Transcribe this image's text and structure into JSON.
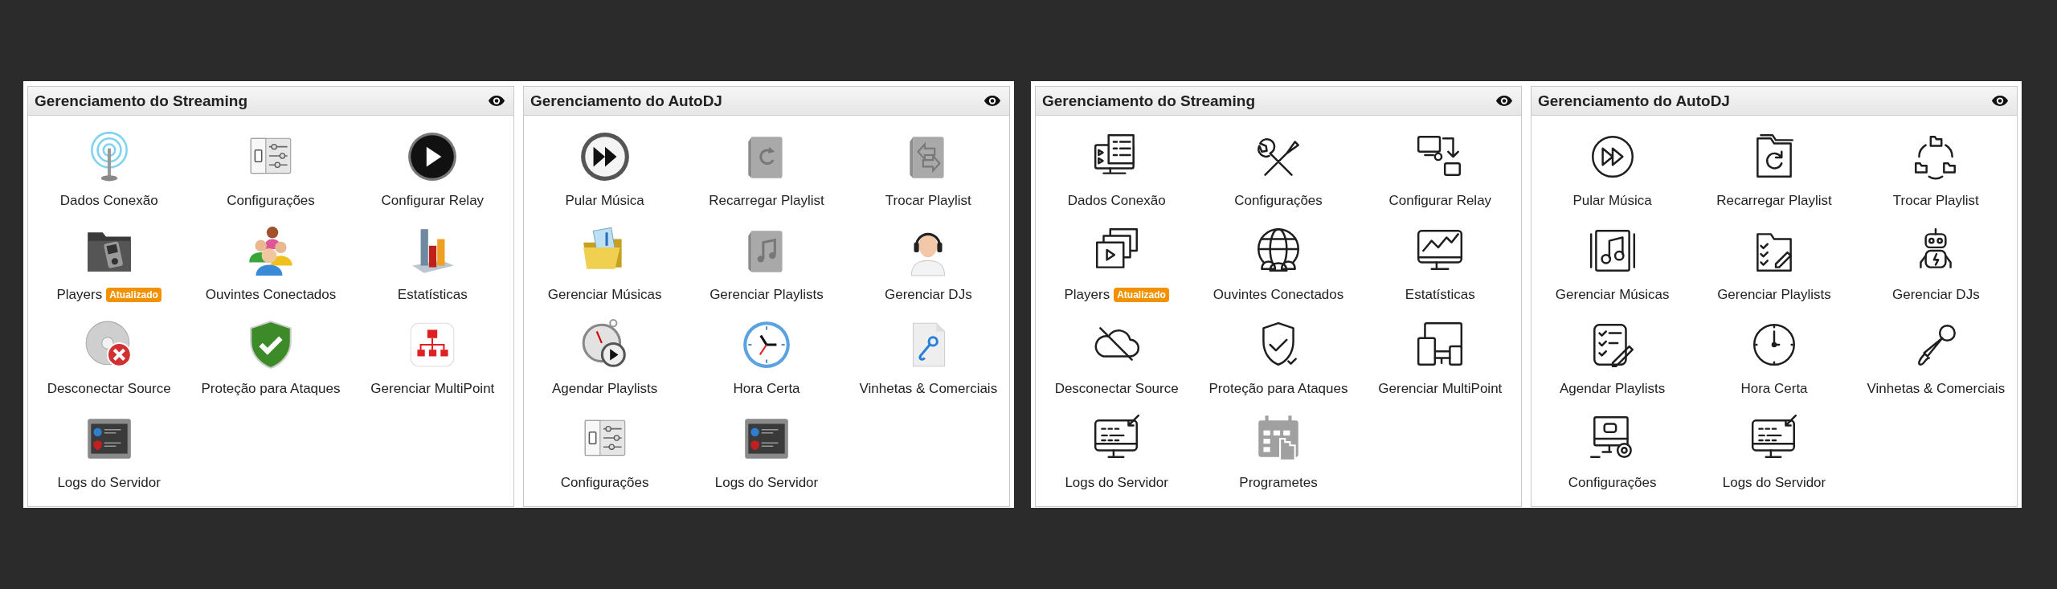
{
  "screens": [
    {
      "panels": [
        {
          "title": "Gerenciamento do Streaming",
          "items": [
            {
              "label": "Dados Conexão"
            },
            {
              "label": "Configurações"
            },
            {
              "label": "Configurar Relay"
            },
            {
              "label": "Players",
              "badge": "Atualizado"
            },
            {
              "label": "Ouvintes Conectados"
            },
            {
              "label": "Estatísticas"
            },
            {
              "label": "Desconectar Source"
            },
            {
              "label": "Proteção para Ataques"
            },
            {
              "label": "Gerenciar MultiPoint"
            },
            {
              "label": "Logs do Servidor"
            }
          ]
        },
        {
          "title": "Gerenciamento do AutoDJ",
          "items": [
            {
              "label": "Pular Música"
            },
            {
              "label": "Recarregar Playlist"
            },
            {
              "label": "Trocar Playlist"
            },
            {
              "label": "Gerenciar Músicas"
            },
            {
              "label": "Gerenciar Playlists"
            },
            {
              "label": "Gerenciar DJs"
            },
            {
              "label": "Agendar Playlists"
            },
            {
              "label": "Hora Certa"
            },
            {
              "label": "Vinhetas & Comerciais"
            },
            {
              "label": "Configurações"
            },
            {
              "label": "Logs do Servidor"
            }
          ]
        }
      ]
    },
    {
      "panels": [
        {
          "title": "Gerenciamento do Streaming",
          "items": [
            {
              "label": "Dados Conexão"
            },
            {
              "label": "Configurações"
            },
            {
              "label": "Configurar Relay"
            },
            {
              "label": "Players",
              "badge": "Atualizado"
            },
            {
              "label": "Ouvintes Conectados"
            },
            {
              "label": "Estatísticas"
            },
            {
              "label": "Desconectar Source"
            },
            {
              "label": "Proteção para Ataques"
            },
            {
              "label": "Gerenciar MultiPoint"
            },
            {
              "label": "Logs do Servidor"
            },
            {
              "label": "Programetes"
            }
          ]
        },
        {
          "title": "Gerenciamento do AutoDJ",
          "items": [
            {
              "label": "Pular Música"
            },
            {
              "label": "Recarregar Playlist"
            },
            {
              "label": "Trocar Playlist"
            },
            {
              "label": "Gerenciar Músicas"
            },
            {
              "label": "Gerenciar Playlists"
            },
            {
              "label": "Gerenciar DJs"
            },
            {
              "label": "Agendar Playlists"
            },
            {
              "label": "Hora Certa"
            },
            {
              "label": "Vinhetas & Comerciais"
            },
            {
              "label": "Configurações"
            },
            {
              "label": "Logs do Servidor"
            }
          ]
        }
      ]
    }
  ]
}
